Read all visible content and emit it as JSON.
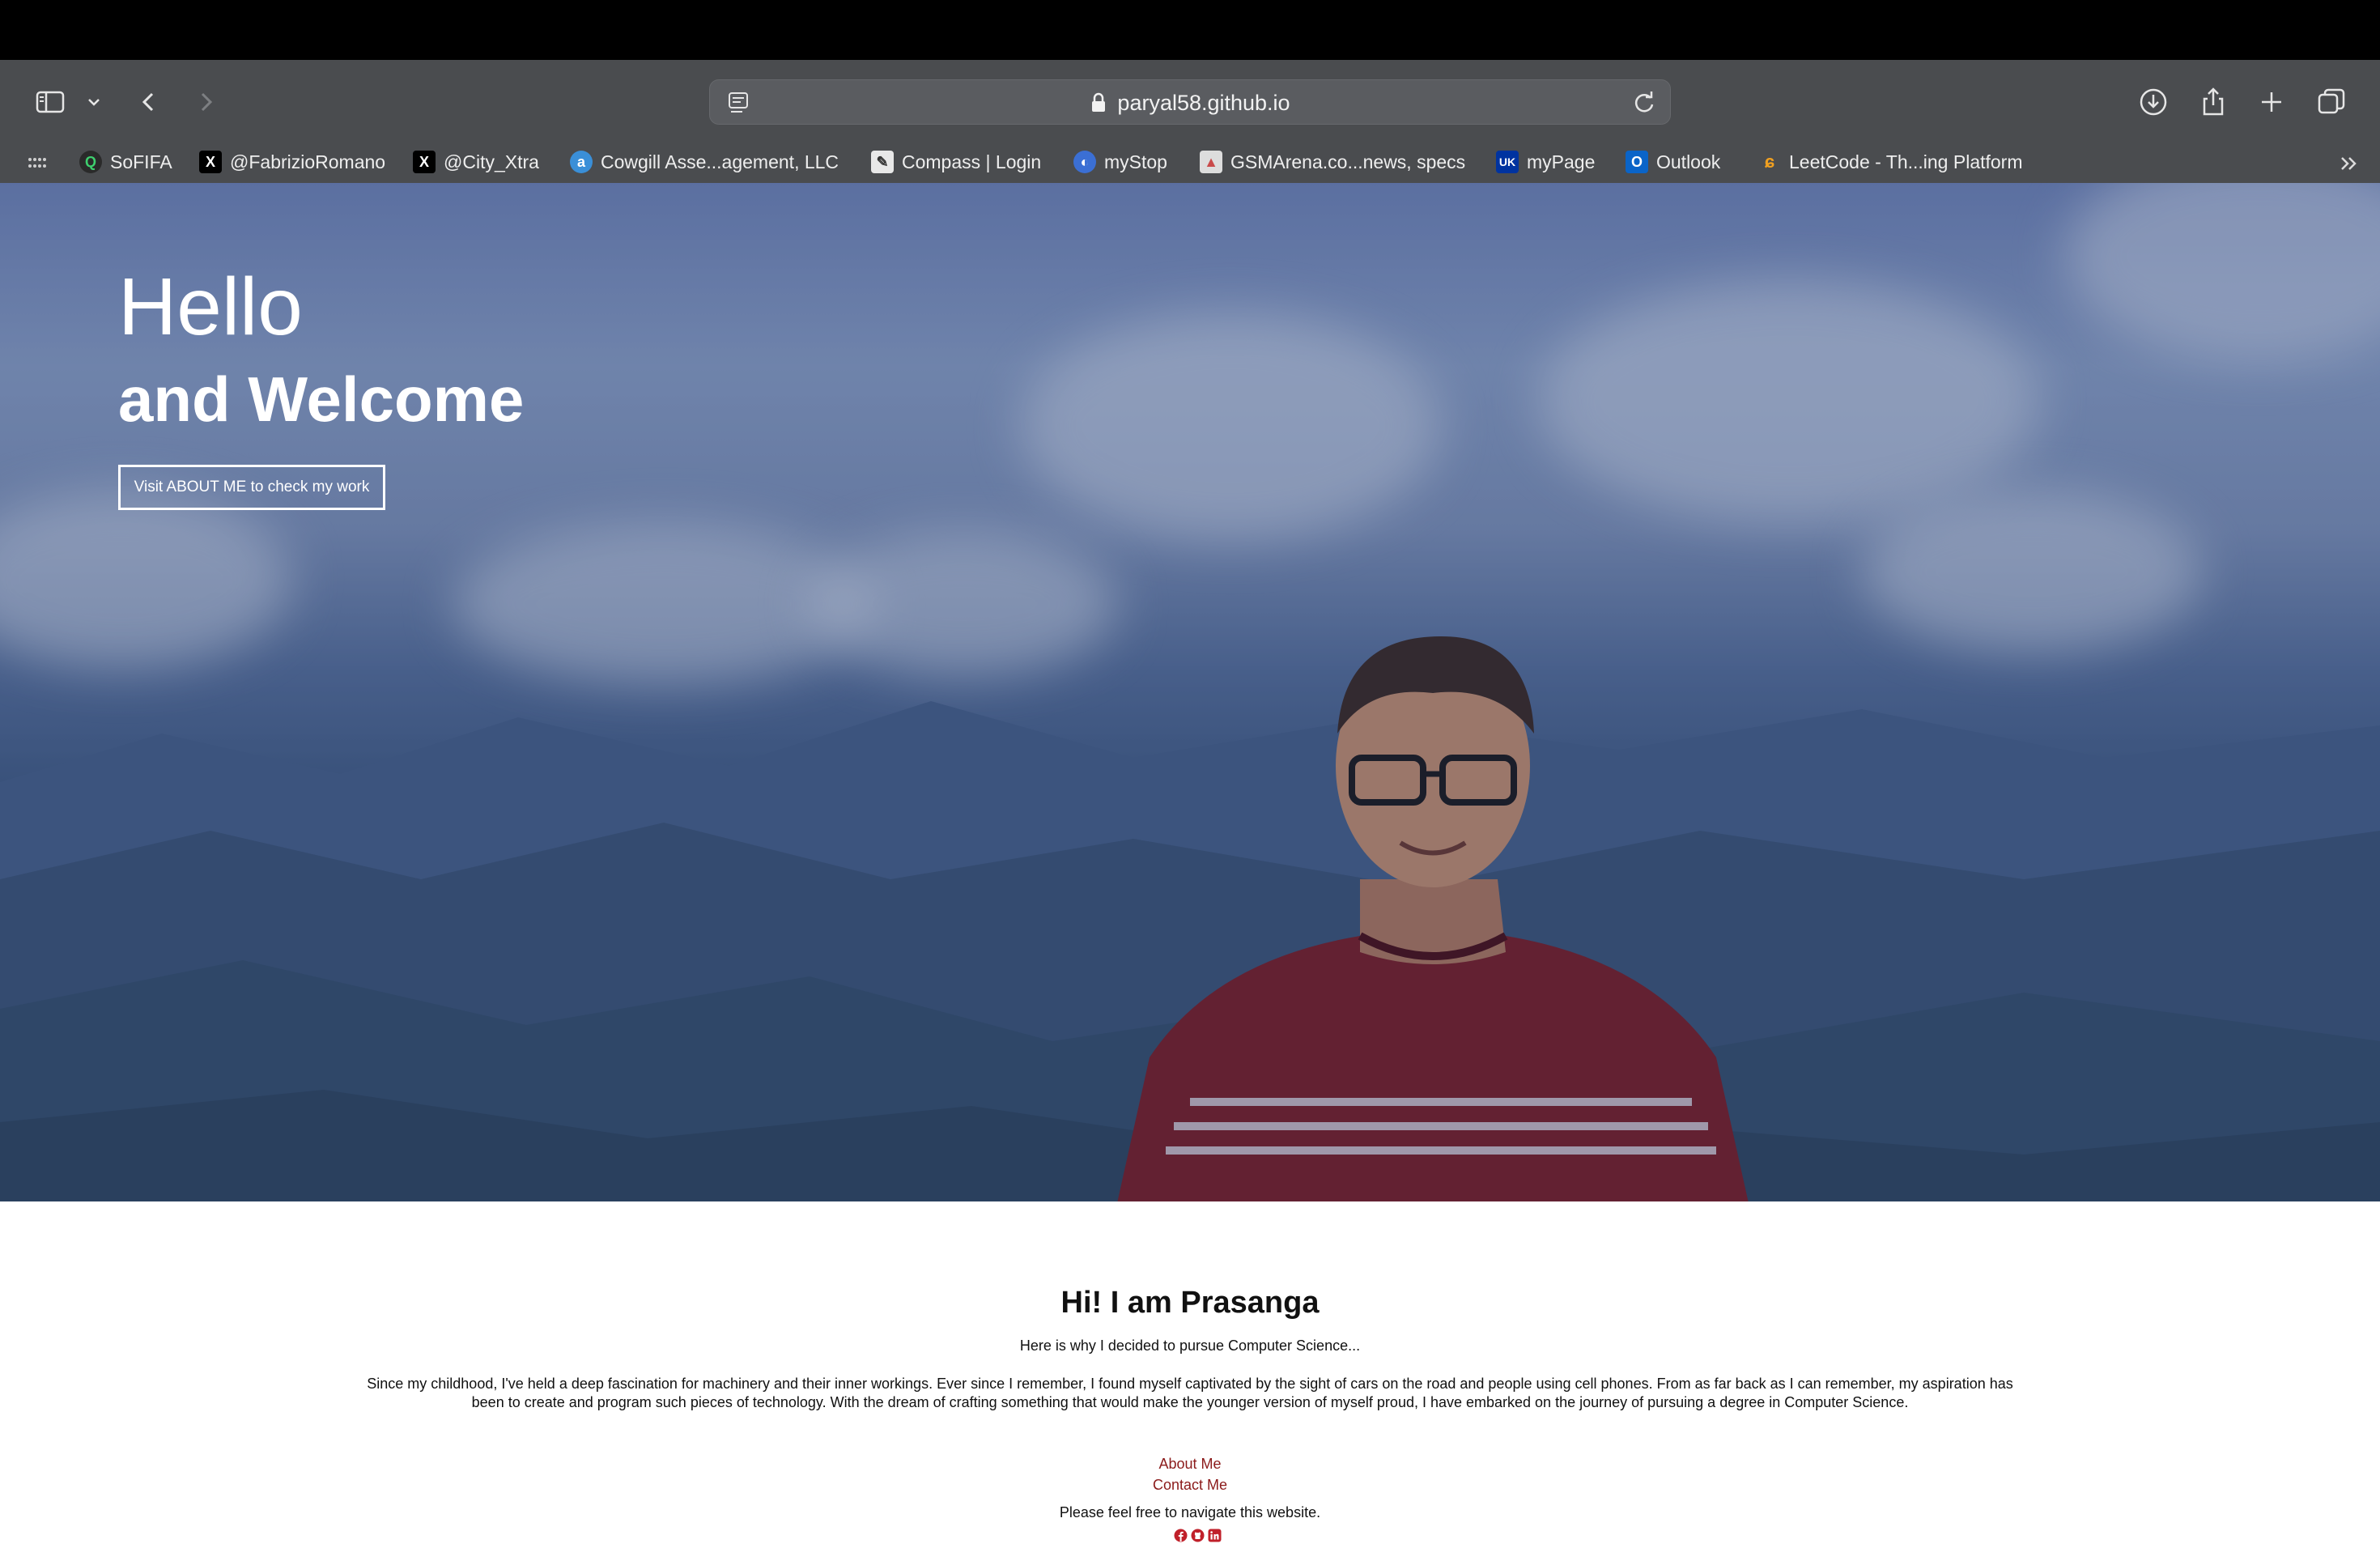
{
  "browser": {
    "url": "paryal58.github.io",
    "bookmarks": [
      {
        "label": "SoFIFA",
        "icon": "sofifa-icon",
        "color": "#1f9d55",
        "glyph": "Q"
      },
      {
        "label": "@FabrizioRomano",
        "icon": "x-icon",
        "color": "#000000",
        "glyph": "X"
      },
      {
        "label": "@City_Xtra",
        "icon": "x-icon",
        "color": "#000000",
        "glyph": "X"
      },
      {
        "label": "Cowgill Asse...agement, LLC",
        "icon": "cowgill-icon",
        "color": "#3a8fd8",
        "glyph": "a"
      },
      {
        "label": "Compass | Login",
        "icon": "compass-icon",
        "color": "#e8e8e8",
        "glyph": ""
      },
      {
        "label": "myStop",
        "icon": "mystop-icon",
        "color": "#3b6fd4",
        "glyph": ""
      },
      {
        "label": "GSMArena.co...news, specs",
        "icon": "gsmarena-icon",
        "color": "#c94a4a",
        "glyph": ""
      },
      {
        "label": "myPage",
        "icon": "uk-icon",
        "color": "#0033a0",
        "glyph": "UK"
      },
      {
        "label": "Outlook",
        "icon": "outlook-icon",
        "color": "#0a64c8",
        "glyph": "O"
      },
      {
        "label": "LeetCode - Th...ing Platform",
        "icon": "leetcode-icon",
        "color": "#f0a020",
        "glyph": ""
      }
    ]
  },
  "hero": {
    "title": "Hello",
    "subtitle": "and Welcome",
    "button": "Visit ABOUT ME to check my work"
  },
  "content": {
    "title": "Hi! I am Prasanga",
    "subtitle": "Here is why I decided to pursue Computer Science...",
    "paragraph": "Since my childhood, I've held a deep fascination for machinery and their inner workings. Ever since I remember, I found myself captivated by the sight of cars on the road and people using cell phones. From as far back as I can remember, my aspiration has been to create and program such pieces of technology. With the dream of crafting something that would make the younger version of myself proud, I have embarked on the journey of pursuing a degree in Computer Science.",
    "link_about": "About Me",
    "link_contact": "Contact Me",
    "nav_note": "Please feel free to navigate this website.",
    "socials": [
      "facebook-icon",
      "github-icon",
      "linkedin-icon"
    ]
  },
  "colors": {
    "link": "#8b1a1a",
    "chrome": "#4a4c4f"
  }
}
